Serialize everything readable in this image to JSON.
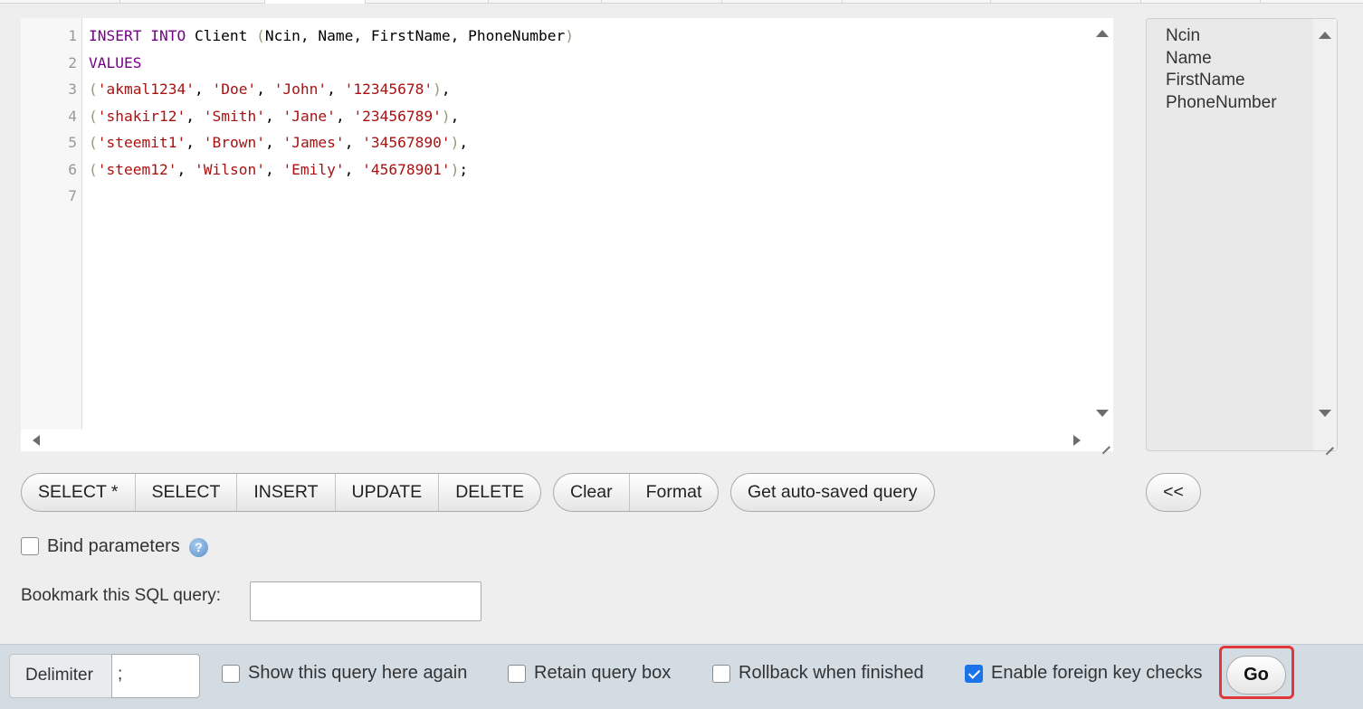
{
  "editor": {
    "line_numbers": [
      "1",
      "2",
      "3",
      "4",
      "5",
      "6",
      "7"
    ],
    "lines": [
      [
        {
          "t": "INSERT INTO",
          "c": "kw"
        },
        {
          "t": " Client ",
          "c": ""
        },
        {
          "t": "(",
          "c": "br"
        },
        {
          "t": "Ncin, Name, FirstName, PhoneNumber",
          "c": ""
        },
        {
          "t": ")",
          "c": "br"
        }
      ],
      [
        {
          "t": "VALUES",
          "c": "kw"
        }
      ],
      [
        {
          "t": "(",
          "c": "br"
        },
        {
          "t": "'akmal1234'",
          "c": "str"
        },
        {
          "t": ", ",
          "c": ""
        },
        {
          "t": "'Doe'",
          "c": "str"
        },
        {
          "t": ", ",
          "c": ""
        },
        {
          "t": "'John'",
          "c": "str"
        },
        {
          "t": ", ",
          "c": ""
        },
        {
          "t": "'12345678'",
          "c": "str"
        },
        {
          "t": ")",
          "c": "br"
        },
        {
          "t": ",",
          "c": ""
        }
      ],
      [
        {
          "t": "(",
          "c": "br"
        },
        {
          "t": "'shakir12'",
          "c": "str"
        },
        {
          "t": ", ",
          "c": ""
        },
        {
          "t": "'Smith'",
          "c": "str"
        },
        {
          "t": ", ",
          "c": ""
        },
        {
          "t": "'Jane'",
          "c": "str"
        },
        {
          "t": ", ",
          "c": ""
        },
        {
          "t": "'23456789'",
          "c": "str"
        },
        {
          "t": ")",
          "c": "br"
        },
        {
          "t": ",",
          "c": ""
        }
      ],
      [
        {
          "t": "(",
          "c": "br"
        },
        {
          "t": "'steemit1'",
          "c": "str"
        },
        {
          "t": ", ",
          "c": ""
        },
        {
          "t": "'Brown'",
          "c": "str"
        },
        {
          "t": ", ",
          "c": ""
        },
        {
          "t": "'James'",
          "c": "str"
        },
        {
          "t": ", ",
          "c": ""
        },
        {
          "t": "'34567890'",
          "c": "str"
        },
        {
          "t": ")",
          "c": "br"
        },
        {
          "t": ",",
          "c": ""
        }
      ],
      [
        {
          "t": "(",
          "c": "br"
        },
        {
          "t": "'steem12'",
          "c": "str"
        },
        {
          "t": ", ",
          "c": ""
        },
        {
          "t": "'Wilson'",
          "c": "str"
        },
        {
          "t": ", ",
          "c": ""
        },
        {
          "t": "'Emily'",
          "c": "str"
        },
        {
          "t": ", ",
          "c": ""
        },
        {
          "t": "'45678901'",
          "c": "str"
        },
        {
          "t": ")",
          "c": "br"
        },
        {
          "t": ";",
          "c": ""
        }
      ],
      []
    ],
    "colors": {
      "keyword": "#770088",
      "string": "#aa1111",
      "bracket": "#999977"
    }
  },
  "columns_list": [
    "Ncin",
    "Name",
    "FirstName",
    "PhoneNumber"
  ],
  "buttons": {
    "group1": [
      "SELECT *",
      "SELECT",
      "INSERT",
      "UPDATE",
      "DELETE"
    ],
    "group2": [
      "Clear",
      "Format"
    ],
    "autosave": "Get auto-saved query",
    "toggle": "<<"
  },
  "bind_parameters": {
    "label": "Bind parameters",
    "checked": false
  },
  "bookmark": {
    "label": "Bookmark this SQL query:",
    "value": ""
  },
  "footer": {
    "delimiter_label": "Delimiter",
    "delimiter_value": ";",
    "options": [
      {
        "label": "Show this query here again",
        "checked": false
      },
      {
        "label": "Retain query box",
        "checked": false
      },
      {
        "label": "Rollback when finished",
        "checked": false
      },
      {
        "label": "Enable foreign key checks",
        "checked": true
      }
    ],
    "go_label": "Go"
  },
  "accent_colors": {
    "highlight": "#e0383a",
    "checkbox": "#1a73e8",
    "footer_bg": "#d3dce3"
  }
}
